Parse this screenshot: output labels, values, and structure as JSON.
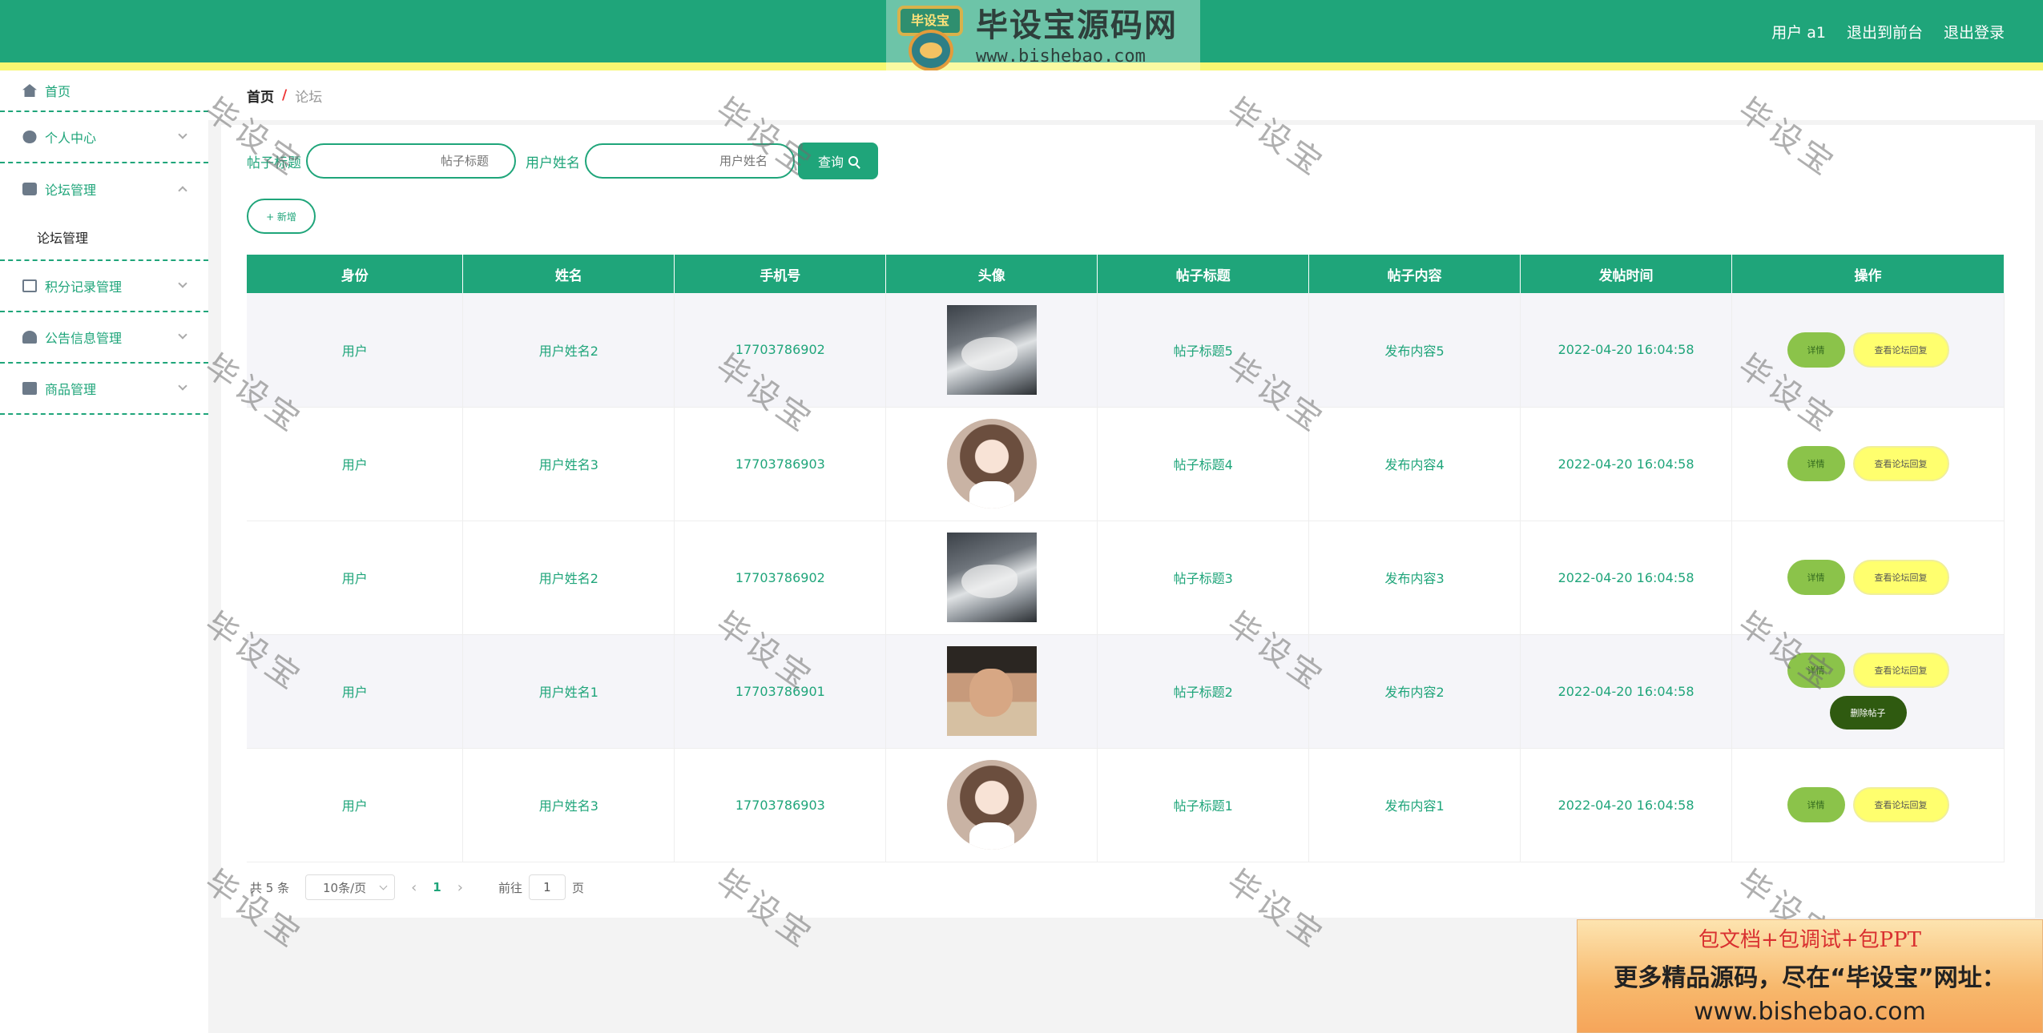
{
  "header": {
    "logo_badge": "毕设宝",
    "logo_title": "毕设宝源码网",
    "logo_url": "www.bishebao.com",
    "user": "用户 a1",
    "back_to_front": "退出到前台",
    "logout": "退出登录",
    "colors": {
      "primary": "#1fa57a",
      "stripe": "#f7f771"
    }
  },
  "sidebar": {
    "items": [
      {
        "label": "首页",
        "icon": "home-icon"
      },
      {
        "label": "个人中心",
        "icon": "user-icon"
      },
      {
        "label": "论坛管理",
        "icon": "forum-icon",
        "expanded": true
      },
      {
        "label": "积分记录管理",
        "icon": "points-icon"
      },
      {
        "label": "公告信息管理",
        "icon": "notice-icon"
      },
      {
        "label": "商品管理",
        "icon": "goods-icon"
      }
    ],
    "submenu": {
      "label": "论坛管理"
    }
  },
  "breadcrumb": {
    "home": "首页",
    "sep": "/",
    "current": "论坛"
  },
  "search": {
    "title_label": "帖子标题",
    "title_placeholder": "帖子标题",
    "name_label": "用户姓名",
    "name_placeholder": "用户姓名",
    "button": "查询"
  },
  "add_button": "+ 新增",
  "table": {
    "headers": [
      "身份",
      "姓名",
      "手机号",
      "头像",
      "帖子标题",
      "帖子内容",
      "发帖时间",
      "操作"
    ],
    "rows": [
      {
        "role": "用户",
        "name": "用户姓名2",
        "phone": "17703786902",
        "avatar": "wolf",
        "title": "帖子标题5",
        "content": "发布内容5",
        "time": "2022-04-20 16:04:58"
      },
      {
        "role": "用户",
        "name": "用户姓名3",
        "phone": "17703786903",
        "avatar": "girl",
        "title": "帖子标题4",
        "content": "发布内容4",
        "time": "2022-04-20 16:04:58"
      },
      {
        "role": "用户",
        "name": "用户姓名2",
        "phone": "17703786902",
        "avatar": "wolf",
        "title": "帖子标题3",
        "content": "发布内容3",
        "time": "2022-04-20 16:04:58"
      },
      {
        "role": "用户",
        "name": "用户姓名1",
        "phone": "17703786901",
        "avatar": "boy",
        "title": "帖子标题2",
        "content": "发布内容2",
        "time": "2022-04-20 16:04:58"
      },
      {
        "role": "用户",
        "name": "用户姓名3",
        "phone": "17703786903",
        "avatar": "girl",
        "title": "帖子标题1",
        "content": "发布内容1",
        "time": "2022-04-20 16:04:58"
      }
    ],
    "actions": {
      "detail": "详情",
      "reply": "查看论坛回复",
      "delete": "删除帖子"
    }
  },
  "pager": {
    "total": "共 5 条",
    "page_size": "10条/页",
    "current_page": "1",
    "goto_label": "前往",
    "goto_value": "1",
    "page_suffix": "页"
  },
  "watermark": "毕设宝",
  "ad": {
    "line1": "包文档+包调试+包PPT",
    "line2": "更多精品源码，尽在“毕设宝”网址：",
    "line3": "www.bishebao.com"
  }
}
